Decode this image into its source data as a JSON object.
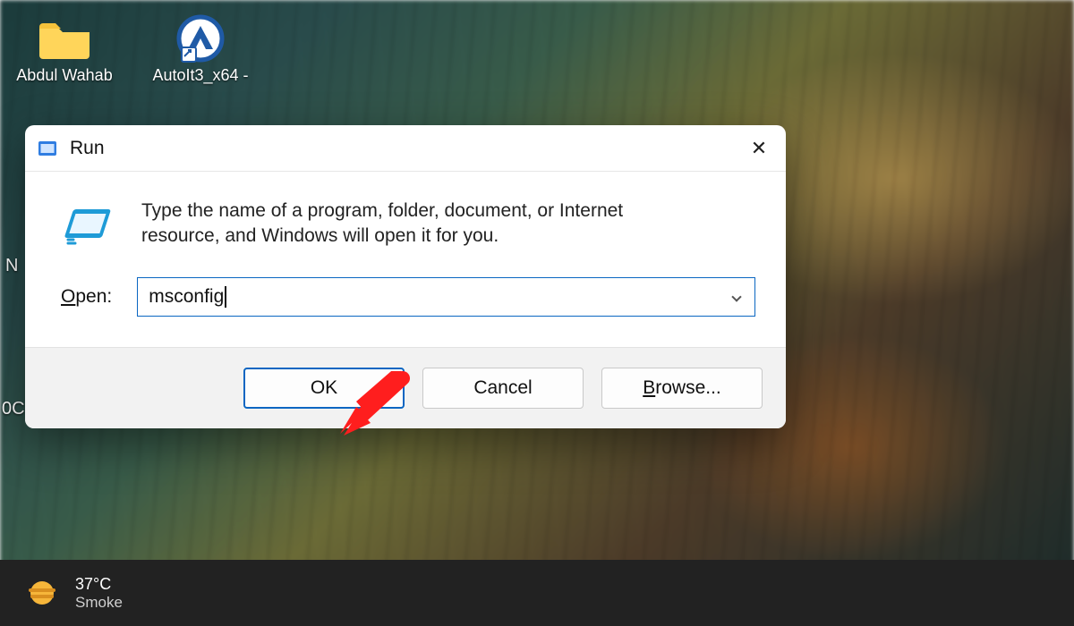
{
  "desktop": {
    "icons": [
      {
        "name": "folder-abdul-wahab",
        "label": "Abdul Wahab",
        "type": "folder"
      },
      {
        "name": "app-autoit3-x64",
        "label": "AutoIt3_x64 -",
        "type": "app-shortcut"
      }
    ],
    "peek_labels": {
      "left1": "N",
      "left2": "0C"
    }
  },
  "dialog": {
    "title": "Run",
    "description": "Type the name of a program, folder, document, or Internet resource, and Windows will open it for you.",
    "open_label_prefix": "O",
    "open_label_rest": "pen:",
    "input_value": "msconfig",
    "buttons": {
      "ok": "OK",
      "cancel": "Cancel",
      "browse_prefix": "B",
      "browse_rest": "rowse..."
    }
  },
  "taskbar": {
    "temperature": "37°C",
    "condition": "Smoke"
  },
  "annotation": {
    "arrow_color": "#ff1e1e"
  }
}
